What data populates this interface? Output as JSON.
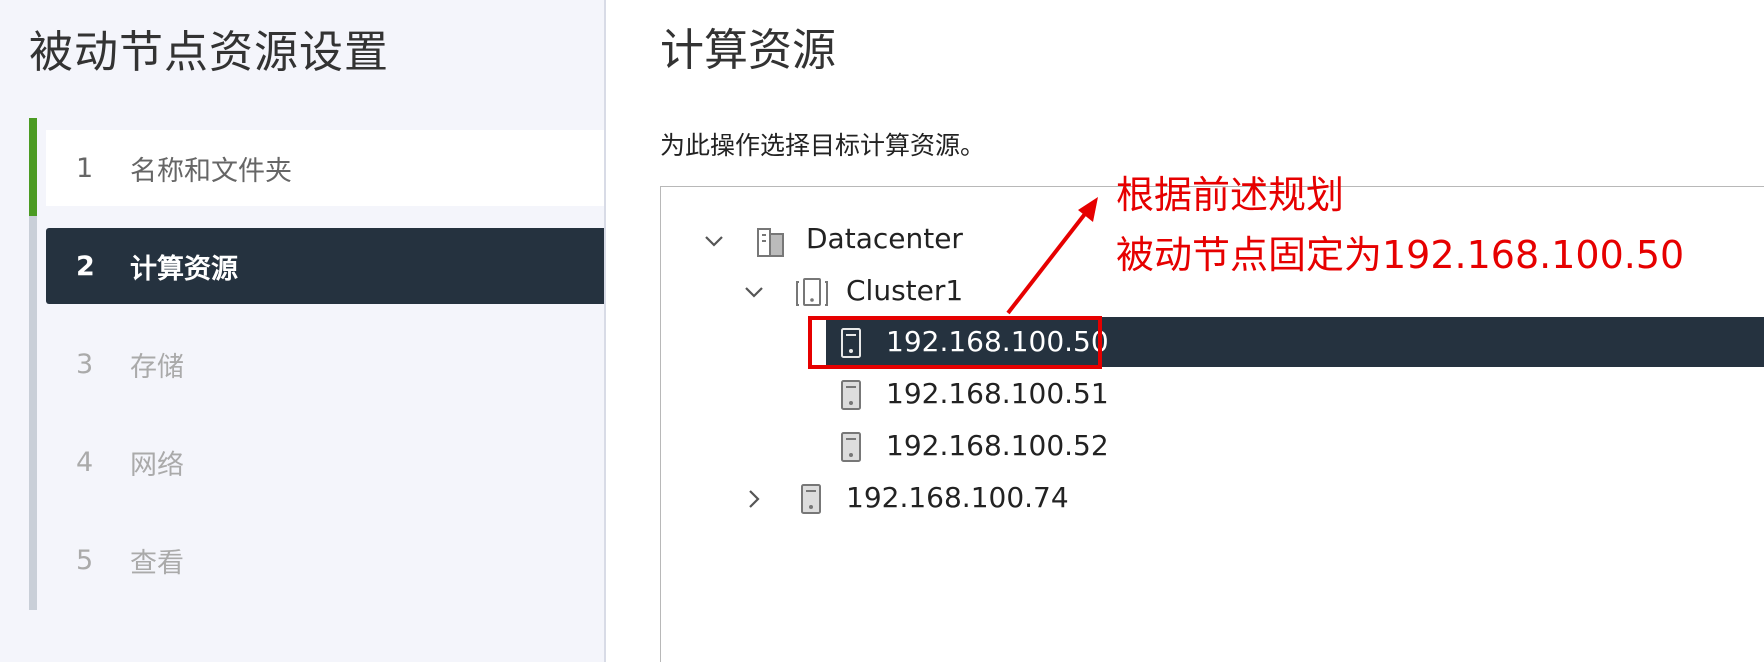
{
  "wizard": {
    "title": "被动节点资源设置",
    "steps": [
      {
        "num": "1",
        "label": "名称和文件夹",
        "state": "completed"
      },
      {
        "num": "2",
        "label": "计算资源",
        "state": "active"
      },
      {
        "num": "3",
        "label": "存储",
        "state": "disabled"
      },
      {
        "num": "4",
        "label": "网络",
        "state": "disabled"
      },
      {
        "num": "5",
        "label": "查看",
        "state": "disabled"
      }
    ]
  },
  "content": {
    "title": "计算资源",
    "subtitle": "为此操作选择目标计算资源。"
  },
  "tree": {
    "datacenter": {
      "label": "Datacenter",
      "icon": "datacenter-icon",
      "expanded": true
    },
    "cluster": {
      "label": "Cluster1",
      "icon": "cluster-icon",
      "expanded": true
    },
    "hosts": [
      {
        "label": "192.168.100.50",
        "icon": "host-icon",
        "selected": true
      },
      {
        "label": "192.168.100.51",
        "icon": "host-icon",
        "selected": false
      },
      {
        "label": "192.168.100.52",
        "icon": "host-icon",
        "selected": false
      }
    ],
    "standalone_host": {
      "label": "192.168.100.74",
      "icon": "host-icon",
      "expanded": false
    }
  },
  "annotation": {
    "line1": "根据前述规划",
    "line2": "被动节点固定为192.168.100.50",
    "color": "#e60000"
  },
  "colors": {
    "active_bg": "#25323f",
    "completed_accent": "#4b9b23",
    "sidebar_bg": "#f4f5fb"
  }
}
